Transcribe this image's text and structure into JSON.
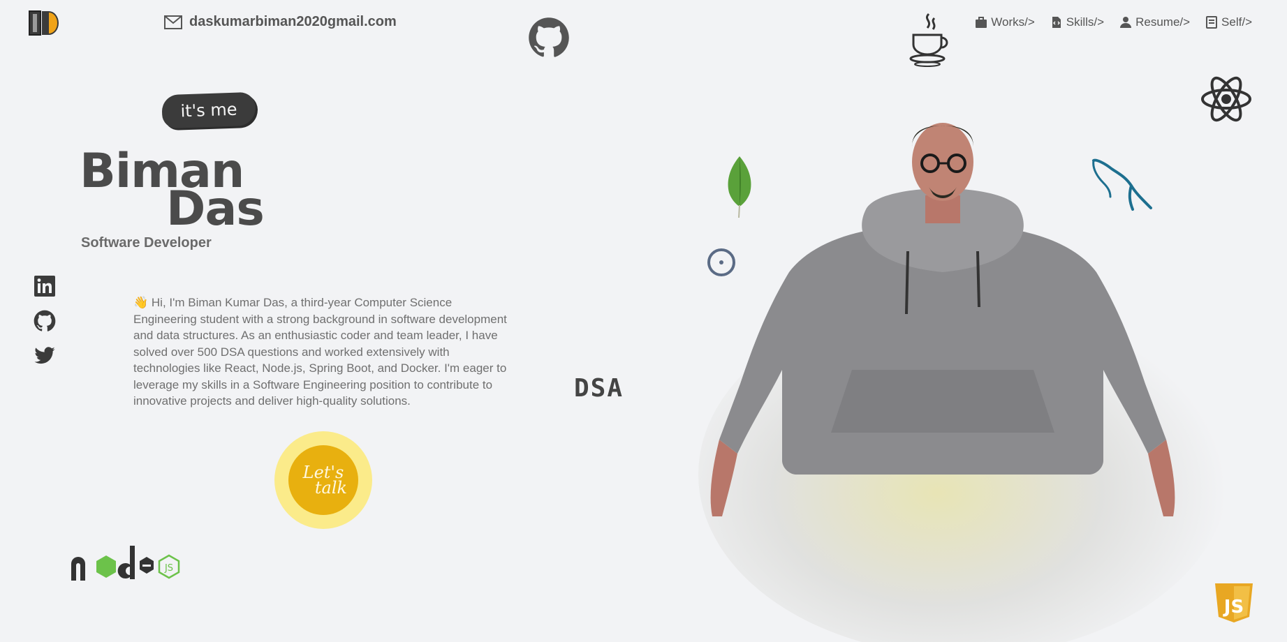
{
  "header": {
    "logo_alt": "BD",
    "email": "daskumarbiman2020gmail.com",
    "nav": [
      {
        "label": "Works/>",
        "icon": "briefcase-icon"
      },
      {
        "label": "Skills/>",
        "icon": "code-file-icon"
      },
      {
        "label": "Resume/>",
        "icon": "user-icon"
      },
      {
        "label": "Self/>",
        "icon": "id-card-icon"
      }
    ]
  },
  "hero": {
    "badge": "it's me",
    "first_name": "Biman",
    "last_name": "Das",
    "role": "Software Developer",
    "bio": "👋 Hi, I'm Biman Kumar Das, a third-year Computer Science Engineering student with a strong background in software development and data structures. As an enthusiastic coder and team leader, I have solved over 500 DSA questions and worked extensively with technologies like React, Node.js, Spring Boot, and Docker. I'm eager to leverage my skills in a Software Engineering position to contribute to innovative projects and deliver high-quality solutions.",
    "cta_line1": "Let's",
    "cta_line2": "talk"
  },
  "floating": {
    "dsa": "DSA"
  },
  "colors": {
    "background": "#f2f3f5",
    "cta_outer": "#fbeb8a",
    "cta_inner": "#e8b00f",
    "mongo_green": "#5aa13a",
    "node_green": "#6cc24a",
    "mysql_blue": "#1d6f8f",
    "js_yellow": "#e8a723"
  }
}
